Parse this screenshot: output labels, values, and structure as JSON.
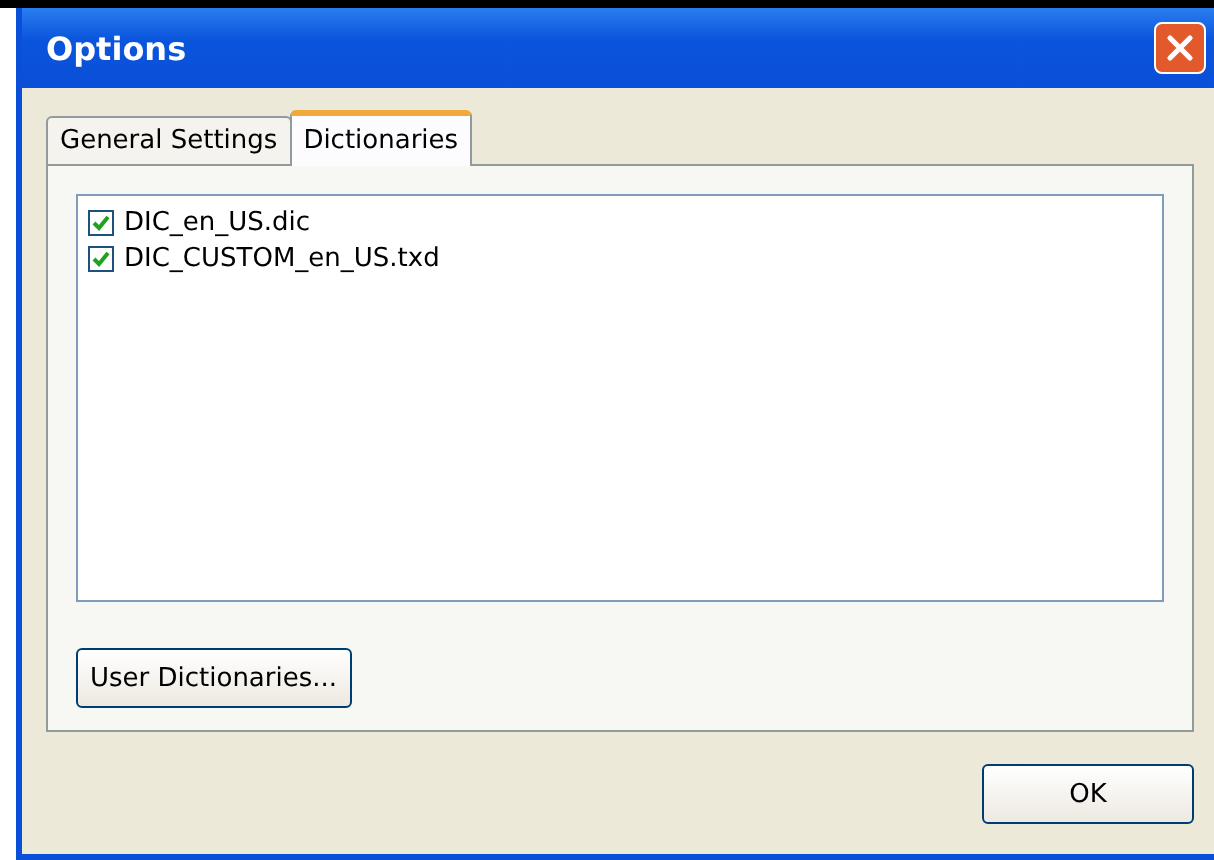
{
  "window": {
    "title": "Options"
  },
  "tabs": [
    {
      "label": "General Settings",
      "selected": false
    },
    {
      "label": "Dictionaries",
      "selected": true
    }
  ],
  "dictionaries": [
    {
      "label": "DIC_en_US.dic",
      "checked": true
    },
    {
      "label": "DIC_CUSTOM_en_US.txd",
      "checked": true
    }
  ],
  "panel_button": "User Dictionaries...",
  "buttons": [
    "OK"
  ]
}
